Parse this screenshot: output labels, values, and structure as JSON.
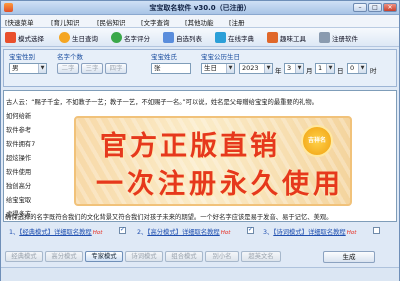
{
  "window": {
    "title": "宝宝取名软件 v30.0（已注册）"
  },
  "menu": [
    "[快速菜单",
    "[育儿知识",
    "[民俗知识",
    "[文字查询",
    "[其他功能",
    "[注册"
  ],
  "toolbar": {
    "items": [
      {
        "label": "模式选择",
        "icon": "mode-icon"
      },
      {
        "label": "生日查询",
        "icon": "birthday-icon"
      },
      {
        "label": "名字评分",
        "icon": "score-icon"
      },
      {
        "label": "自选列表",
        "icon": "list-icon"
      },
      {
        "label": "在线字典",
        "icon": "dictionary-icon"
      },
      {
        "label": "趣味工具",
        "icon": "tools-icon"
      },
      {
        "label": "注册软件",
        "icon": "register-icon"
      }
    ]
  },
  "form": {
    "gender_label": "宝宝性别",
    "gender_value": "男",
    "name_count_label": "名字个数",
    "name_count_options": [
      "二字",
      "三字",
      "四字"
    ],
    "surname_label": "宝宝姓氏",
    "surname_value": "张",
    "birth_label": "宝宝公历生日",
    "date_type": "生日",
    "year": "2023",
    "year_unit": "年",
    "month": "3",
    "month_unit": "月",
    "day": "1",
    "day_unit": "日",
    "hour": "0",
    "hour_unit": "时"
  },
  "text_lines": [
    "古人云：“赐子千金，不如教子一艺；教子一艺，不如赐子一名。”可以说，姓名是父母赠给宝宝的最重要的礼物。",
    "如何给新",
    "软件参考",
    "软件拥有7",
    "超炫操作",
    "软件使用",
    "独创高分",
    "给宝宝取",
    "虑得多方",
    "确保选择的名字既符合我们的文化背景又符合我们对孩子未来的期望。一个好名字应该是易于发音、易于记忆、美观。"
  ],
  "banner": {
    "line1": "官方正版直销",
    "line2": "一次注册永久使用",
    "badge": "吉祥名"
  },
  "links": [
    {
      "prefix": "1、",
      "label": "【经典模式】详细取名教程",
      "hot": "Hot",
      "checked": true
    },
    {
      "prefix": "2、",
      "label": "【高分模式】详细取名教程",
      "hot": "Hot",
      "checked": true
    },
    {
      "prefix": "3、",
      "label": "【诗词模式】详细取名教程",
      "hot": "Hot",
      "checked": false
    }
  ],
  "tabs": [
    "经典模式",
    "高分模式",
    "专家模式",
    "诗词模式",
    "组合模式",
    "别小名",
    "超英文名"
  ],
  "active_tab": "专家模式",
  "generate_button": "生成",
  "colors": {
    "accent": "#1d4fa0",
    "hot": "#e8281b",
    "banner_text": "#e6381c"
  }
}
